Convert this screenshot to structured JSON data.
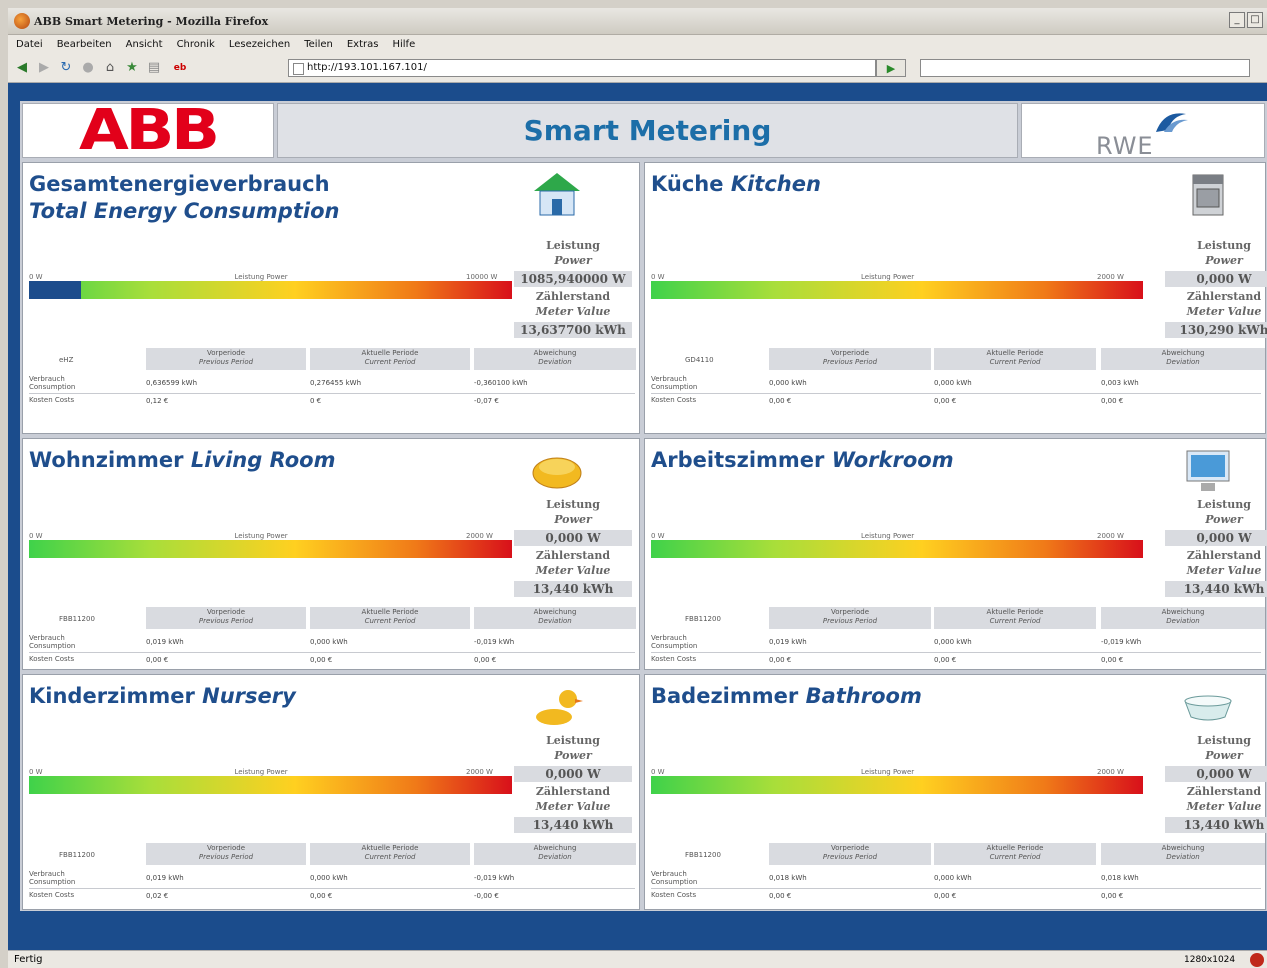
{
  "browser": {
    "title": "ABB Smart Metering - Mozilla Firefox",
    "menu": [
      "Datei",
      "Bearbeiten",
      "Ansicht",
      "Chronik",
      "Lesezeichen",
      "Teilen",
      "Extras",
      "Hilfe"
    ],
    "url": "http://193.101.167.101/",
    "status": "Fertig",
    "resolution": "1280x1024"
  },
  "header": {
    "abb_logo": "ABB",
    "title": "Smart Metering",
    "rwe_logo": "RWE"
  },
  "labels": {
    "power_de": "Leistung",
    "power_en": "Power",
    "meter_de": "Zählerstand",
    "meter_en": "Meter Value",
    "scale_center": "Leistung Power",
    "prev_de": "Vorperiode",
    "prev_en": "Previous Period",
    "cur_de": "Aktuelle Periode",
    "cur_en": "Current Period",
    "dev_de": "Abweichung",
    "dev_en": "Deviation",
    "cons_de": "Verbrauch",
    "cons_en": "Consumption",
    "cost": "Kosten Costs"
  },
  "panels": [
    {
      "title_de": "Gesamtenergieverbrauch",
      "title_en": "Total Energy Consumption",
      "icon": "house-icon",
      "scale_min": "0 W",
      "scale_max": "10000 W",
      "power": "1085,940000 W",
      "power_fraction": 0.108,
      "meter": "13,637700 kWh",
      "id": "eHZ",
      "cons_prev": "0,636599 kWh",
      "cons_cur": "0,276455 kWh",
      "cons_dev": "-0,360100 kWh",
      "cost_prev": "0,12 €",
      "cost_cur": "0 €",
      "cost_dev": "-0,07 €"
    },
    {
      "title_de": "Küche",
      "title_en": "Kitchen",
      "icon": "stove-icon",
      "scale_min": "0 W",
      "scale_max": "2000 W",
      "power": "0,000 W",
      "power_fraction": 0,
      "meter": "130,290 kWh",
      "id": "GD4110",
      "cons_prev": "0,000 kWh",
      "cons_cur": "0,000 kWh",
      "cons_dev": "0,003 kWh",
      "cost_prev": "0,00 €",
      "cost_cur": "0,00 €",
      "cost_dev": "0,00 €"
    },
    {
      "title_de": "Wohnzimmer",
      "title_en": "Living Room",
      "icon": "sofa-icon",
      "scale_min": "0 W",
      "scale_max": "2000 W",
      "power": "0,000 W",
      "power_fraction": 0,
      "meter": "13,440 kWh",
      "id": "FBB11200",
      "cons_prev": "0,019 kWh",
      "cons_cur": "0,000 kWh",
      "cons_dev": "-0,019 kWh",
      "cost_prev": "0,00 €",
      "cost_cur": "0,00 €",
      "cost_dev": "0,00 €"
    },
    {
      "title_de": "Arbeitszimmer",
      "title_en": "Workroom",
      "icon": "monitor-icon",
      "scale_min": "0 W",
      "scale_max": "2000 W",
      "power": "0,000 W",
      "power_fraction": 0,
      "meter": "13,440 kWh",
      "id": "FBB11200",
      "cons_prev": "0,019 kWh",
      "cons_cur": "0,000 kWh",
      "cons_dev": "-0,019 kWh",
      "cost_prev": "0,00 €",
      "cost_cur": "0,00 €",
      "cost_dev": "0,00 €"
    },
    {
      "title_de": "Kinderzimmer",
      "title_en": "Nursery",
      "icon": "duck-icon",
      "scale_min": "0 W",
      "scale_max": "2000 W",
      "power": "0,000 W",
      "power_fraction": 0,
      "meter": "13,440 kWh",
      "id": "FBB11200",
      "cons_prev": "0,019 kWh",
      "cons_cur": "0,000 kWh",
      "cons_dev": "-0,019 kWh",
      "cost_prev": "0,02 €",
      "cost_cur": "0,00 €",
      "cost_dev": "-0,00 €"
    },
    {
      "title_de": "Badezimmer",
      "title_en": "Bathroom",
      "icon": "bathtub-icon",
      "scale_min": "0 W",
      "scale_max": "2000 W",
      "power": "0,000 W",
      "power_fraction": 0,
      "meter": "13,440 kWh",
      "id": "FBB11200",
      "cons_prev": "0,018 kWh",
      "cons_cur": "0,000 kWh",
      "cons_dev": "0,018 kWh",
      "cost_prev": "0,00 €",
      "cost_cur": "0,00 €",
      "cost_dev": "0,00 €"
    }
  ]
}
